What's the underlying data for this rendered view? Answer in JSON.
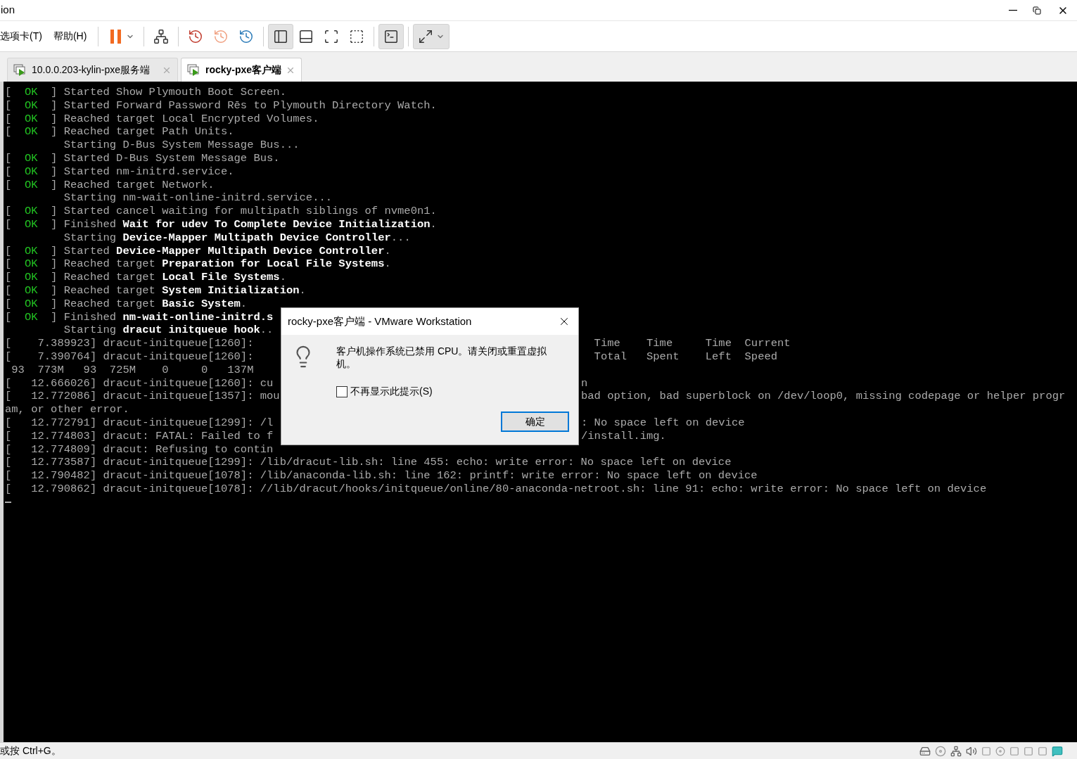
{
  "window": {
    "title": "ion"
  },
  "menu": [
    {
      "label": "选项卡(T)"
    },
    {
      "label": "帮助(H)"
    }
  ],
  "toolbar": [
    {
      "kind": "pause",
      "pressed": false
    },
    {
      "kind": "send-keys",
      "pressed": false
    },
    {
      "kind": "snapshot-take",
      "pressed": false
    },
    {
      "kind": "snapshot-revert",
      "pressed": false
    },
    {
      "kind": "snapshot-manage",
      "pressed": false
    },
    {
      "kind": "view-library",
      "pressed": true
    },
    {
      "kind": "view-thumbnail",
      "pressed": false
    },
    {
      "kind": "view-full",
      "pressed": false
    },
    {
      "kind": "view-unity",
      "pressed": false
    },
    {
      "kind": "console",
      "pressed": true
    },
    {
      "kind": "stretch",
      "pressed": true
    }
  ],
  "tabs": [
    {
      "label": "10.0.0.203-kylin-pxe服务端",
      "selected": false
    },
    {
      "label": "rocky-pxe客户端",
      "selected": true
    }
  ],
  "terminal": {
    "lines": [
      {
        "kind": "status",
        "lb": "[",
        "status": "OK",
        "rb": "]",
        "text": "Started Show Plymouth Boot Screen."
      },
      {
        "kind": "status",
        "lb": "[",
        "status": "OK",
        "rb": "]",
        "text": "Started Forward Password Rēs to Plymouth Directory Watch."
      },
      {
        "kind": "status",
        "lb": "[",
        "status": "OK",
        "rb": "]",
        "text": "Reached target Local Encrypted Volumes."
      },
      {
        "kind": "status",
        "lb": "[",
        "status": "OK",
        "rb": "]",
        "text": "Reached target Path Units."
      },
      {
        "kind": "continued",
        "text": "Starting D-Bus System Message Bus..."
      },
      {
        "kind": "status",
        "lb": "[",
        "status": "OK",
        "rb": "]",
        "text": "Started D-Bus System Message Bus."
      },
      {
        "kind": "status",
        "lb": "[",
        "status": "OK",
        "rb": "]",
        "text": "Started nm-initrd.service."
      },
      {
        "kind": "status",
        "lb": "[",
        "status": "OK",
        "rb": "]",
        "text": "Reached target Network."
      },
      {
        "kind": "continued",
        "text": "Starting nm-wait-online-initrd.service..."
      },
      {
        "kind": "status",
        "lb": "[",
        "status": "OK",
        "rb": "]",
        "text": "Started cancel waiting for multipath siblings of nvme0n1."
      },
      {
        "kind": "status",
        "lb": "[",
        "status": "OK",
        "rb": "]",
        "text": "Finished **Wait for udev To Complete Device Initialization**."
      },
      {
        "kind": "continued",
        "text": "Starting **Device-Mapper Multipath Device Controller**..."
      },
      {
        "kind": "status",
        "lb": "[",
        "status": "OK",
        "rb": "]",
        "text": "Started **Device-Mapper Multipath Device Controller**."
      },
      {
        "kind": "status",
        "lb": "[",
        "status": "OK",
        "rb": "]",
        "text": "Reached target **Preparation for Local File Systems**."
      },
      {
        "kind": "status",
        "lb": "[",
        "status": "OK",
        "rb": "]",
        "text": "Reached target **Local File Systems**."
      },
      {
        "kind": "status",
        "lb": "[",
        "status": "OK",
        "rb": "]",
        "text": "Reached target **System Initialization**."
      },
      {
        "kind": "status",
        "lb": "[",
        "status": "OK",
        "rb": "]",
        "text": "Reached target **Basic System**."
      },
      {
        "kind": "status",
        "lb": "[",
        "status": "OK",
        "rb": "]",
        "text": "Finished **nm-wait-online-initrd.s**"
      },
      {
        "kind": "continued",
        "text": "Starting **dracut initqueue hook**.."
      },
      {
        "kind": "raw",
        "text": "[    7.389923] dracut-initqueue[1260]:",
        "tail": "  Time    Time     Time  Current"
      },
      {
        "kind": "raw",
        "text": "[    7.390764] dracut-initqueue[1260]:",
        "tail": "  Total   Spent    Left  Speed"
      },
      {
        "kind": "raw",
        "text": " 93  773M   93  725M    0     0   137M"
      },
      {
        "kind": "raw",
        "text": "[   12.666026] dracut-initqueue[1260]: cu",
        "tail": "n"
      },
      {
        "kind": "raw",
        "text": "[   12.772086] dracut-initqueue[1357]: mou",
        "tail": "bad option, bad superblock on /dev/loop0, missing codepage or helper progr"
      },
      {
        "kind": "raw",
        "text": "am, or other error."
      },
      {
        "kind": "raw",
        "text": "[   12.772791] dracut-initqueue[1299]: /l",
        "tail": ": No space left on device"
      },
      {
        "kind": "raw",
        "text": "[   12.774803] dracut: FATAL: Failed to f",
        "tail": "/install.img."
      },
      {
        "kind": "raw",
        "text": "[   12.774809] dracut: Refusing to contin"
      },
      {
        "kind": "raw",
        "text": "[   12.773587] dracut-initqueue[1299]: /lib/dracut-lib.sh: line 455: echo: write error: No space left on device"
      },
      {
        "kind": "raw",
        "text": "[   12.790482] dracut-initqueue[1078]: /lib/anaconda-lib.sh: line 162: printf: write error: No space left on device"
      },
      {
        "kind": "raw",
        "text": "[   12.790862] dracut-initqueue[1078]: //lib/dracut/hooks/initqueue/online/80-anaconda-netroot.sh: line 91: echo: write error: No space left on device"
      }
    ]
  },
  "dialog": {
    "title": "rocky-pxe客户端 - VMware Workstation",
    "message": "客户机操作系统已禁用 CPU。请关闭或重置虚拟机。",
    "checkbox": {
      "label": "不再显示此提示(S)",
      "checked": false
    },
    "button": "确定"
  },
  "status_bar": {
    "text": "或按 Ctrl+G。"
  }
}
